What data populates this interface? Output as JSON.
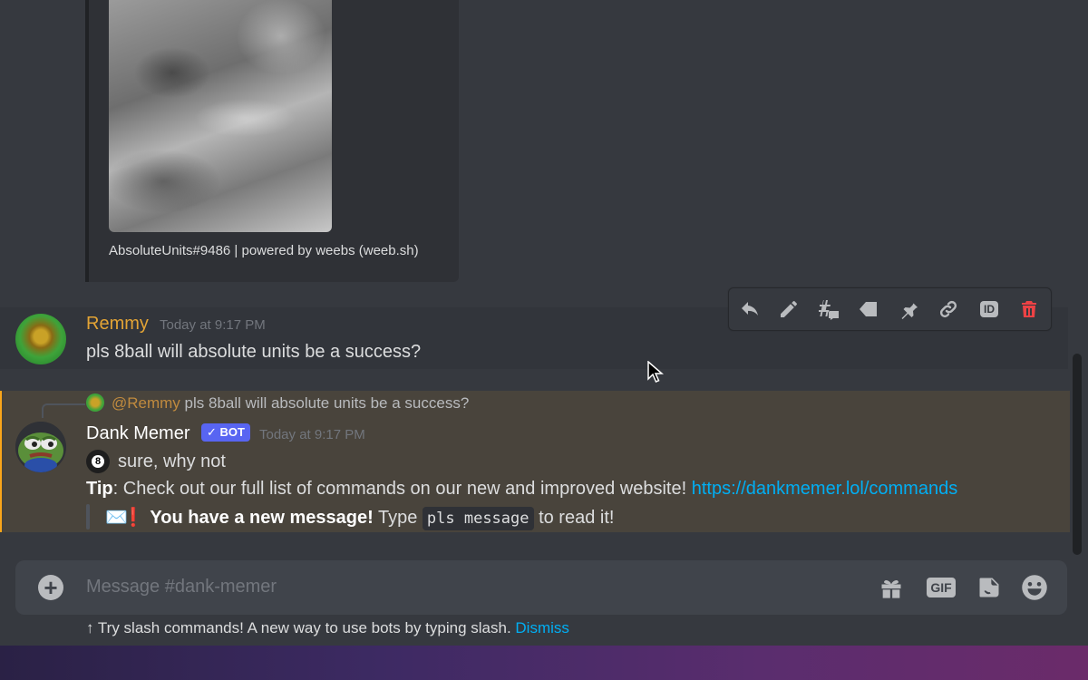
{
  "embed": {
    "footer": "AbsoluteUnits#9486 | powered by weebs (weeb.sh)"
  },
  "toolbar": {
    "icons": [
      "reply-icon",
      "edit-icon",
      "thread-icon",
      "tag-icon",
      "pin-icon",
      "link-icon",
      "id-icon",
      "delete-icon"
    ],
    "id_label": "ID"
  },
  "message1": {
    "username": "Remmy",
    "username_color": "#e3a435",
    "timestamp": "Today at 9:17 PM",
    "content": "pls 8ball will absolute units be a success?"
  },
  "message2": {
    "reply_mention": "@Remmy",
    "reply_text": "pls 8ball will absolute units be a success?",
    "username": "Dank Memer",
    "bot_tag": "✓ BOT",
    "timestamp": "Today at 9:17 PM",
    "eightball_glyph": "8",
    "answer": "sure, why not",
    "tip_label": "Tip",
    "tip_text": ": Check out our full list of commands on our new and improved website! ",
    "tip_link": "https://dankmemer.lol/commands",
    "notice_emoji": "✉️",
    "notice_exclaim": "❗",
    "notice_bold": "You have a new message!",
    "notice_pre": "Type",
    "notice_code": "pls message",
    "notice_post": "to read it!"
  },
  "composer": {
    "placeholder": "Message #dank-memer",
    "gif_label": "GIF"
  },
  "slash_tip": {
    "arrow": "↑",
    "text": "Try slash commands! A new way to use bots by typing slash.",
    "dismiss": "Dismiss"
  },
  "colors": {
    "background": "#36393f",
    "mention_highlight": "#49443c",
    "link": "#00aff4",
    "bot_tag": "#5865f2",
    "delete": "#ed4245"
  }
}
